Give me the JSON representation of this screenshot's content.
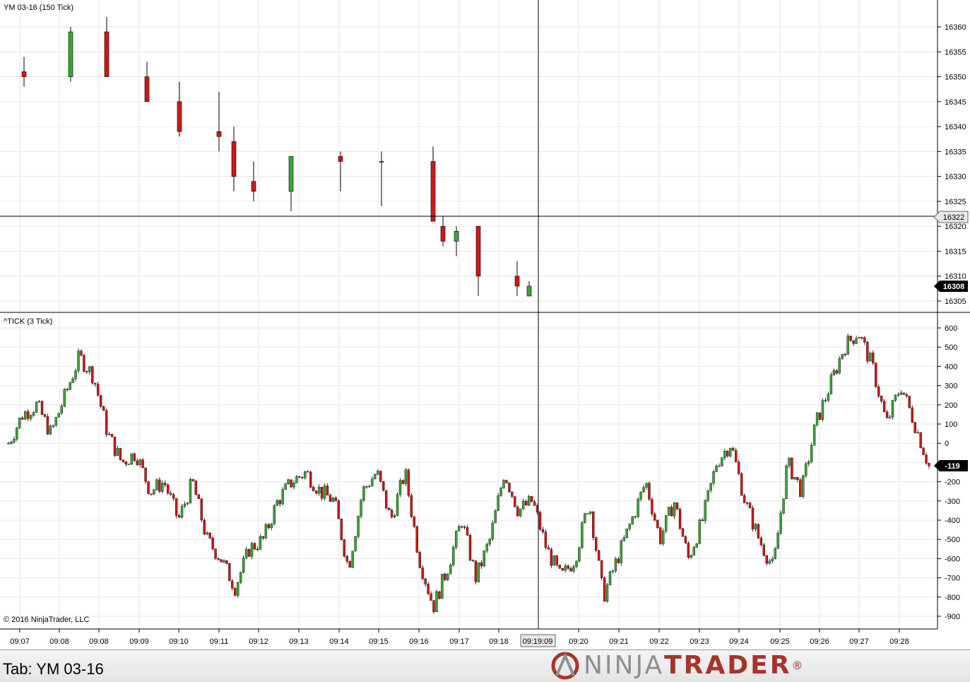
{
  "app": {
    "name": "NinjaTrader"
  },
  "colors": {
    "up": "#3aa53a",
    "down": "#d01818",
    "grid": "#e6e6e6",
    "crosshair": "#000000"
  },
  "top_panel": {
    "title": "YM 03-16 (150 Tick)",
    "crosshair_price": "16322",
    "last_price": "16308"
  },
  "bottom_panel": {
    "title": "^TICK (3 Tick)",
    "last_value": "-119",
    "copyright": "© 2016 NinjaTrader, LLC"
  },
  "time_axis": {
    "labels": [
      "09:07",
      "09:08",
      "09:08",
      "09:09",
      "09:10",
      "09:11",
      "09:12",
      "09:13",
      "09:14",
      "09:15",
      "09:16",
      "09:17",
      "09:18",
      "09:20",
      "09:21",
      "09:22",
      "09:23",
      "09:24",
      "09:25",
      "09:26",
      "09:27",
      "09:28"
    ],
    "crosshair_time": "09:19:09"
  },
  "footer": {
    "tab_label": "Tab: YM 03-16",
    "brand_ninja": "NINJA",
    "brand_trader": "TRADER",
    "brand_reg": "®"
  },
  "chart_data": [
    {
      "type": "candlestick",
      "title": "YM 03-16 (150 Tick)",
      "y_ticks": [
        16305,
        16310,
        16315,
        16320,
        16325,
        16330,
        16335,
        16340,
        16345,
        16350,
        16355,
        16360
      ],
      "ylim": [
        16303,
        16364
      ],
      "grid": true,
      "candles": [
        {
          "time": "09:07",
          "open": 16351,
          "high": 16354,
          "low": 16348,
          "close": 16350
        },
        {
          "time": "09:08",
          "open": 16350,
          "high": 16360,
          "low": 16349,
          "close": 16359
        },
        {
          "time": "09:08",
          "open": 16359,
          "high": 16362,
          "low": 16350,
          "close": 16350
        },
        {
          "time": "09:09",
          "open": 16350,
          "high": 16353,
          "low": 16345,
          "close": 16345
        },
        {
          "time": "09:10",
          "open": 16345,
          "high": 16349,
          "low": 16338,
          "close": 16339
        },
        {
          "time": "09:11",
          "open": 16339,
          "high": 16347,
          "low": 16335,
          "close": 16338
        },
        {
          "time": "09:11",
          "open": 16337,
          "high": 16340,
          "low": 16327,
          "close": 16330
        },
        {
          "time": "09:12",
          "open": 16329,
          "high": 16333,
          "low": 16325,
          "close": 16327
        },
        {
          "time": "09:13",
          "open": 16327,
          "high": 16334,
          "low": 16323,
          "close": 16334
        },
        {
          "time": "09:14",
          "open": 16334,
          "high": 16335,
          "low": 16327,
          "close": 16333
        },
        {
          "time": "09:15",
          "open": 16333,
          "high": 16335,
          "low": 16324,
          "close": 16333
        },
        {
          "time": "09:16",
          "open": 16333,
          "high": 16336,
          "low": 16321,
          "close": 16321
        },
        {
          "time": "09:16",
          "open": 16320,
          "high": 16322,
          "low": 16316,
          "close": 16317
        },
        {
          "time": "09:17",
          "open": 16317,
          "high": 16320,
          "low": 16314,
          "close": 16319
        },
        {
          "time": "09:17",
          "open": 16320,
          "high": 16320,
          "low": 16306,
          "close": 16310
        },
        {
          "time": "09:18",
          "open": 16310,
          "high": 16313,
          "low": 16306,
          "close": 16308
        },
        {
          "time": "09:19",
          "open": 16306,
          "high": 16309,
          "low": 16306,
          "close": 16308
        }
      ]
    },
    {
      "type": "candlestick",
      "title": "^TICK (3 Tick)",
      "y_ticks": [
        -900,
        -800,
        -700,
        -600,
        -500,
        -400,
        -300,
        -200,
        -100,
        0,
        100,
        200,
        300,
        400,
        500,
        600
      ],
      "ylim": [
        -950,
        620
      ],
      "grid": true,
      "series_path_close": [
        {
          "time": "09:07",
          "value": 0
        },
        {
          "time": "09:07",
          "value": 150
        },
        {
          "time": "09:07",
          "value": 200
        },
        {
          "time": "09:08",
          "value": 50
        },
        {
          "time": "09:08",
          "value": 250
        },
        {
          "time": "09:08",
          "value": 450
        },
        {
          "time": "09:08",
          "value": 350
        },
        {
          "time": "09:08",
          "value": 50
        },
        {
          "time": "09:09",
          "value": -100
        },
        {
          "time": "09:09",
          "value": -50
        },
        {
          "time": "09:09",
          "value": -250
        },
        {
          "time": "09:10",
          "value": -200
        },
        {
          "time": "09:10",
          "value": -400
        },
        {
          "time": "09:10",
          "value": -200
        },
        {
          "time": "09:11",
          "value": -500
        },
        {
          "time": "09:11",
          "value": -600
        },
        {
          "time": "09:11",
          "value": -750
        },
        {
          "time": "09:12",
          "value": -550
        },
        {
          "time": "09:12",
          "value": -500
        },
        {
          "time": "09:12",
          "value": -300
        },
        {
          "time": "09:13",
          "value": -200
        },
        {
          "time": "09:13",
          "value": -150
        },
        {
          "time": "09:14",
          "value": -250
        },
        {
          "time": "09:14",
          "value": -300
        },
        {
          "time": "09:14",
          "value": -650
        },
        {
          "time": "09:15",
          "value": -250
        },
        {
          "time": "09:15",
          "value": -150
        },
        {
          "time": "09:15",
          "value": -400
        },
        {
          "time": "09:16",
          "value": -150
        },
        {
          "time": "09:16",
          "value": -600
        },
        {
          "time": "09:16",
          "value": -850
        },
        {
          "time": "09:17",
          "value": -650
        },
        {
          "time": "09:17",
          "value": -400
        },
        {
          "time": "09:17",
          "value": -700
        },
        {
          "time": "09:18",
          "value": -500
        },
        {
          "time": "09:18",
          "value": -150
        },
        {
          "time": "09:18",
          "value": -350
        },
        {
          "time": "09:19",
          "value": -300
        },
        {
          "time": "09:19",
          "value": -550
        },
        {
          "time": "09:19",
          "value": -700
        },
        {
          "time": "09:20",
          "value": -600
        },
        {
          "time": "09:20",
          "value": -300
        },
        {
          "time": "09:20",
          "value": -800
        },
        {
          "time": "09:21",
          "value": -600
        },
        {
          "time": "09:21",
          "value": -400
        },
        {
          "time": "09:21",
          "value": -200
        },
        {
          "time": "09:22",
          "value": -500
        },
        {
          "time": "09:22",
          "value": -300
        },
        {
          "time": "09:22",
          "value": -600
        },
        {
          "time": "09:23",
          "value": -400
        },
        {
          "time": "09:23",
          "value": -100
        },
        {
          "time": "09:23",
          "value": 0
        },
        {
          "time": "09:24",
          "value": -300
        },
        {
          "time": "09:24",
          "value": -500
        },
        {
          "time": "09:24",
          "value": -650
        },
        {
          "time": "09:25",
          "value": -100
        },
        {
          "time": "09:25",
          "value": -250
        },
        {
          "time": "09:25",
          "value": 100
        },
        {
          "time": "09:26",
          "value": 300
        },
        {
          "time": "09:26",
          "value": 500
        },
        {
          "time": "09:27",
          "value": 580
        },
        {
          "time": "09:27",
          "value": 400
        },
        {
          "time": "09:27",
          "value": 100
        },
        {
          "time": "09:28",
          "value": 300
        },
        {
          "time": "09:28",
          "value": 100
        },
        {
          "time": "09:28",
          "value": -119
        }
      ]
    }
  ]
}
